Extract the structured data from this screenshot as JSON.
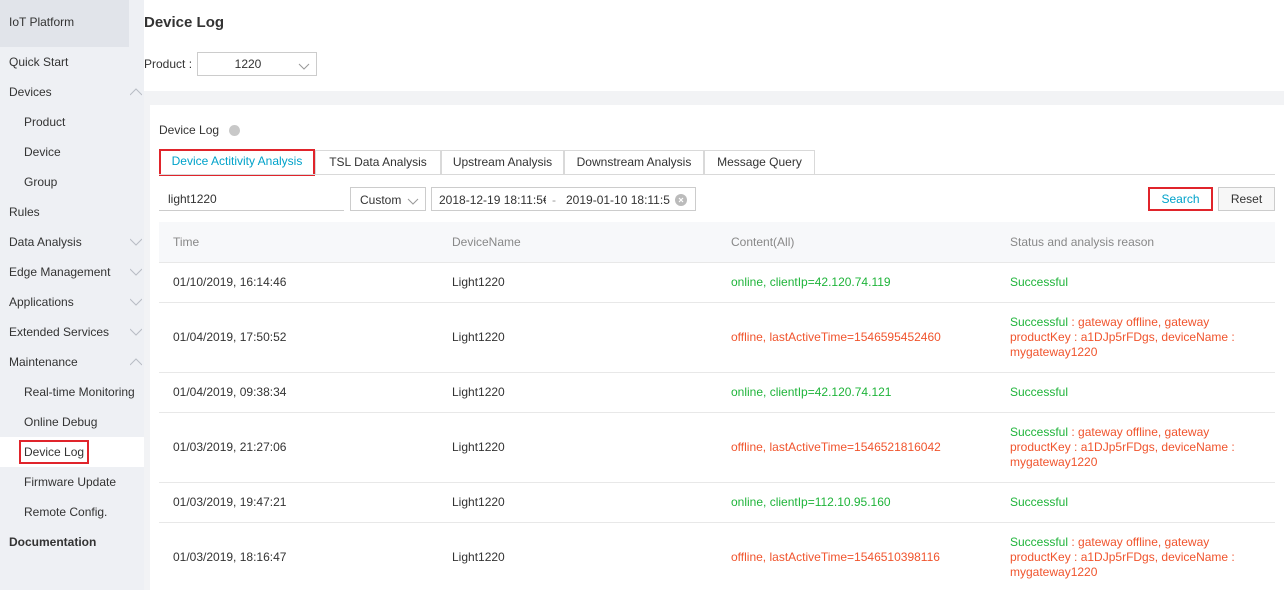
{
  "sidebar": {
    "header": "IoT Platform",
    "items": [
      {
        "label": "Quick Start",
        "level": 0
      },
      {
        "label": "Devices",
        "level": 0,
        "chevron": "up"
      },
      {
        "label": "Product",
        "level": 1
      },
      {
        "label": "Device",
        "level": 1
      },
      {
        "label": "Group",
        "level": 1
      },
      {
        "label": "Rules",
        "level": 0
      },
      {
        "label": "Data Analysis",
        "level": 0,
        "chevron": "down"
      },
      {
        "label": "Edge Management",
        "level": 0,
        "chevron": "down"
      },
      {
        "label": "Applications",
        "level": 0,
        "chevron": "down"
      },
      {
        "label": "Extended Services",
        "level": 0,
        "chevron": "down"
      },
      {
        "label": "Maintenance",
        "level": 0,
        "chevron": "up"
      },
      {
        "label": "Real-time Monitoring",
        "level": 1
      },
      {
        "label": "Online Debug",
        "level": 1
      },
      {
        "label": "Device Log",
        "level": 1,
        "active": true
      },
      {
        "label": "Firmware Update",
        "level": 1
      },
      {
        "label": "Remote Config.",
        "level": 1
      },
      {
        "label": "Documentation",
        "level": 0,
        "bold": true
      }
    ]
  },
  "page": {
    "title": "Device Log",
    "product_label": "Product :",
    "product_value": "1220"
  },
  "section": {
    "title": "Device Log",
    "help_icon": "question-circle-icon"
  },
  "tabs": [
    {
      "label": "Device Actitivity Analysis",
      "active": true
    },
    {
      "label": "TSL Data Analysis"
    },
    {
      "label": "Upstream Analysis"
    },
    {
      "label": "Downstream Analysis"
    },
    {
      "label": "Message Query"
    }
  ],
  "filters": {
    "device_name": "light1220",
    "range_type": "Custom",
    "start_time": "2018-12-19 18:11:5€",
    "separator": "-",
    "end_time": "2019-01-10 18:11:5",
    "search_label": "Search",
    "reset_label": "Reset"
  },
  "table": {
    "columns": [
      "Time",
      "DeviceName",
      "Content(All)",
      "Status and analysis reason"
    ],
    "rows": [
      {
        "time": "01/10/2019, 16:14:46",
        "device": "Light1220",
        "content": "online, clientIp=42.120.74.119",
        "content_color": "green",
        "status": "Successful",
        "reason": ""
      },
      {
        "time": "01/04/2019, 17:50:52",
        "device": "Light1220",
        "content": "offline, lastActiveTime=1546595452460",
        "content_color": "red",
        "status": "Successful",
        "reason": "gateway offline, gateway productKey : a1DJp5rFDgs, deviceName : mygateway1220"
      },
      {
        "time": "01/04/2019, 09:38:34",
        "device": "Light1220",
        "content": "online, clientIp=42.120.74.121",
        "content_color": "green",
        "status": "Successful",
        "reason": ""
      },
      {
        "time": "01/03/2019, 21:27:06",
        "device": "Light1220",
        "content": "offline, lastActiveTime=1546521816042",
        "content_color": "red",
        "status": "Successful",
        "reason": "gateway offline, gateway productKey : a1DJp5rFDgs, deviceName : mygateway1220"
      },
      {
        "time": "01/03/2019, 19:47:21",
        "device": "Light1220",
        "content": "online, clientIp=112.10.95.160",
        "content_color": "green",
        "status": "Successful",
        "reason": ""
      },
      {
        "time": "01/03/2019, 18:16:47",
        "device": "Light1220",
        "content": "offline, lastActiveTime=1546510398116",
        "content_color": "red",
        "status": "Successful",
        "reason": "gateway offline, gateway productKey : a1DJp5rFDgs, deviceName : mygateway1220"
      }
    ],
    "reason_separator": " : "
  },
  "colors": {
    "accent": "#00a2ca",
    "highlight": "#e0242b",
    "success": "#1fb43a",
    "error": "#f0542d"
  }
}
